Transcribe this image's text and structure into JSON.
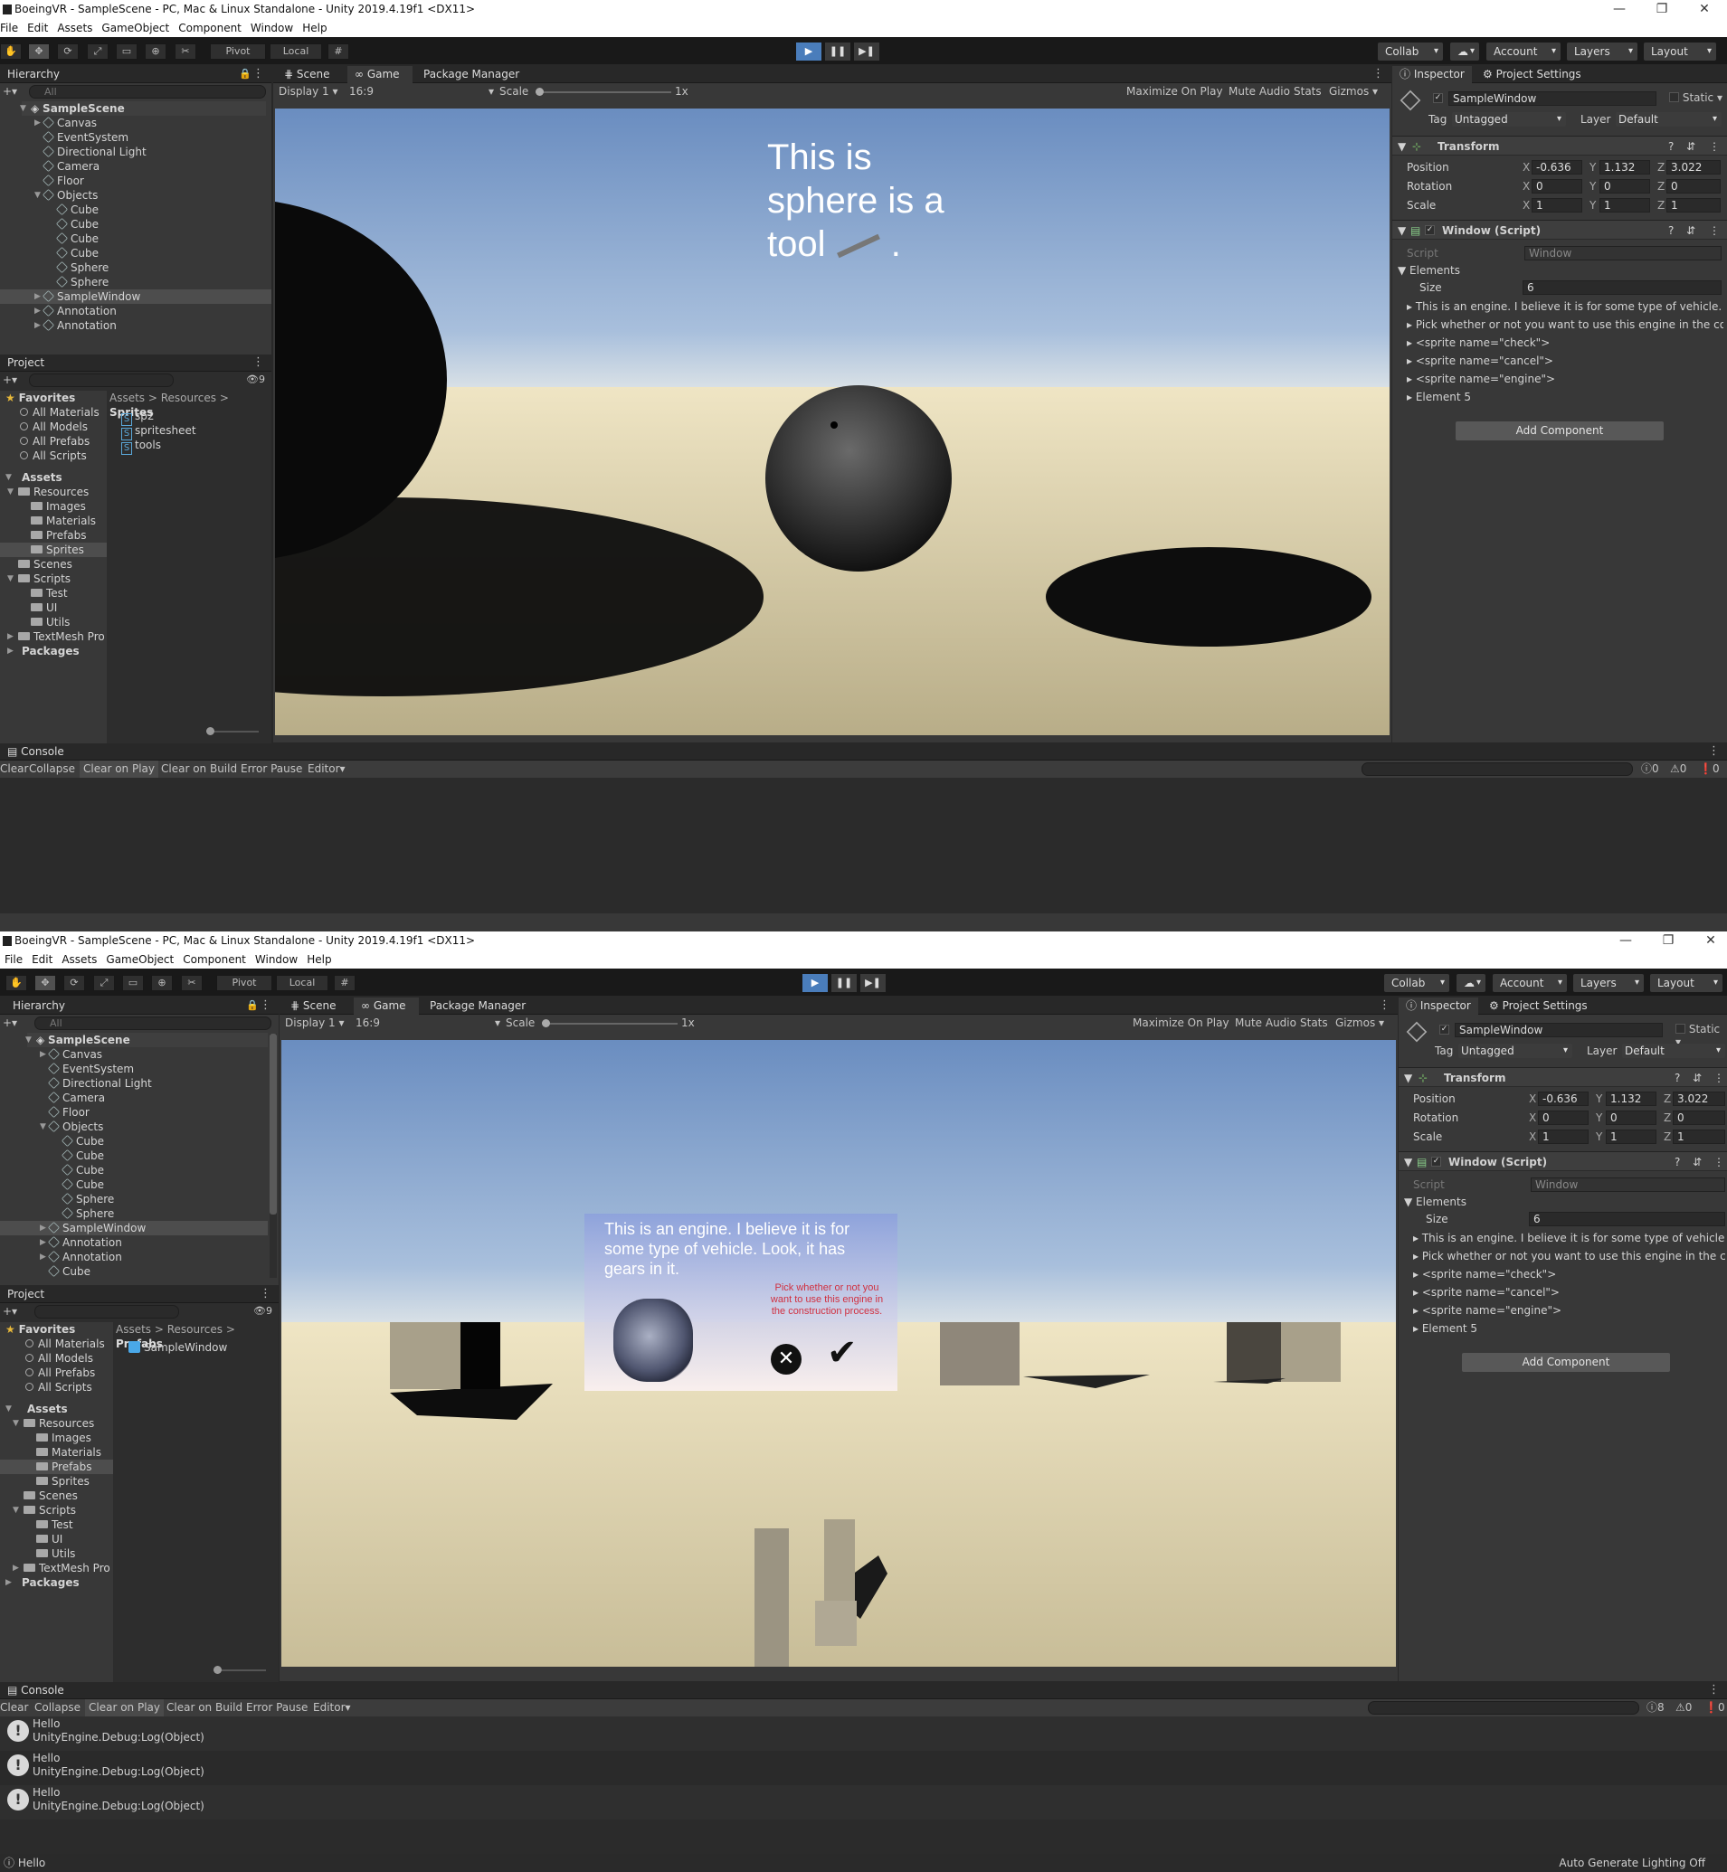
{
  "window": {
    "title": "BoeingVR - SampleScene - PC, Mac & Linux Standalone - Unity 2019.4.19f1 <DX11>",
    "minimize": "—",
    "restore": "❐",
    "close": "✕"
  },
  "menu": [
    "File",
    "Edit",
    "Assets",
    "GameObject",
    "Component",
    "Window",
    "Help"
  ],
  "toolbar": {
    "pivot": "Pivot",
    "local": "Local",
    "collab": "Collab",
    "account": "Account",
    "layers": "Layers",
    "layout": "Layout"
  },
  "hierarchy": {
    "tab": "Hierarchy",
    "search_placeholder": "All",
    "scene": "SampleScene",
    "items_top": [
      "Canvas",
      "EventSystem",
      "Directional Light",
      "Camera",
      "Floor",
      "Objects",
      "Cube",
      "Cube",
      "Cube",
      "Cube",
      "Sphere",
      "Sphere",
      "SampleWindow",
      "Annotation",
      "Annotation"
    ],
    "items_bottom": [
      "Canvas",
      "EventSystem",
      "Directional Light",
      "Camera",
      "Floor",
      "Objects",
      "Cube",
      "Cube",
      "Cube",
      "Cube",
      "Sphere",
      "Sphere",
      "SampleWindow",
      "Annotation",
      "Annotation",
      "Cube"
    ]
  },
  "project": {
    "tab": "Project",
    "hidden_count": "9",
    "favorites": "Favorites",
    "fav_items": [
      "All Materials",
      "All Models",
      "All Prefabs",
      "All Scripts"
    ],
    "assets": "Assets",
    "resources": "Resources",
    "res_children": [
      "Images",
      "Materials",
      "Prefabs",
      "Sprites"
    ],
    "scenes": "Scenes",
    "scripts": "Scripts",
    "script_children": [
      "Test",
      "UI",
      "Utils"
    ],
    "textmesh": "TextMesh Pro",
    "packages": "Packages",
    "top": {
      "breadcrumb": [
        "Assets",
        "Resources",
        "Sprites"
      ],
      "files": [
        "sp2",
        "spritesheet",
        "tools"
      ]
    },
    "bottom": {
      "breadcrumb": [
        "Assets",
        "Resources",
        "Prefabs"
      ],
      "files": [
        "SampleWindow"
      ]
    }
  },
  "view_tabs": {
    "scene": "Scene",
    "game": "Game",
    "package_manager": "Package Manager",
    "display": "Display 1",
    "aspect": "16:9",
    "scale_label": "Scale",
    "scale_value": "1x",
    "maximize": "Maximize On Play",
    "mute": "Mute Audio",
    "stats": "Stats",
    "gizmos": "Gizmos"
  },
  "game_top": {
    "text_lines": [
      "This is",
      "sphere is a",
      "tool"
    ],
    "text_suffix": "."
  },
  "game_bottom": {
    "panel_text": "This is an engine. I believe it is for some type of vehicle. Look, it has gears in it.",
    "panel_prompt": "Pick whether or not you want to use this engine in the construction process."
  },
  "inspector": {
    "tab": "Inspector",
    "settings_tab": "Project Settings",
    "object_name": "SampleWindow",
    "static": "Static",
    "tag_label": "Tag",
    "tag_value": "Untagged",
    "layer_label": "Layer",
    "layer_value": "Default",
    "transform": "Transform",
    "position_label": "Position",
    "rotation_label": "Rotation",
    "scale_label": "Scale",
    "position": {
      "x": "-0.636",
      "y": "1.132",
      "z": "3.022"
    },
    "rotation": {
      "x": "0",
      "y": "0",
      "z": "0"
    },
    "scale": {
      "x": "1",
      "y": "1",
      "z": "1"
    },
    "script_component": "Window (Script)",
    "script_label": "Script",
    "script_value": "Window",
    "elements_label": "Elements",
    "size_label": "Size",
    "size_value": "6",
    "elements": [
      "This is an engine. I believe it is for some type of vehicle. Look, it has gears in it.",
      "Pick whether or not you want to use this engine in the construction process.",
      "<sprite name=\"check\">",
      "<sprite name=\"cancel\">",
      "<sprite name=\"engine\">",
      "Element 5"
    ],
    "add_component": "Add Component"
  },
  "console": {
    "tab": "Console",
    "clear": "Clear",
    "collapse": "Collapse",
    "clear_on_play": "Clear on Play",
    "clear_on_build": "Clear on Build",
    "error_pause": "Error Pause",
    "editor": "Editor",
    "top_counts": {
      "info": "0",
      "warn": "0",
      "error": "0"
    },
    "bottom_counts": {
      "info": "8",
      "warn": "0",
      "error": "0"
    },
    "log_message": "Hello",
    "log_trace": "UnityEngine.Debug:Log(Object)",
    "log_count": 3
  },
  "status": {
    "last_log": "Hello",
    "lighting": "Auto Generate Lighting Off"
  }
}
